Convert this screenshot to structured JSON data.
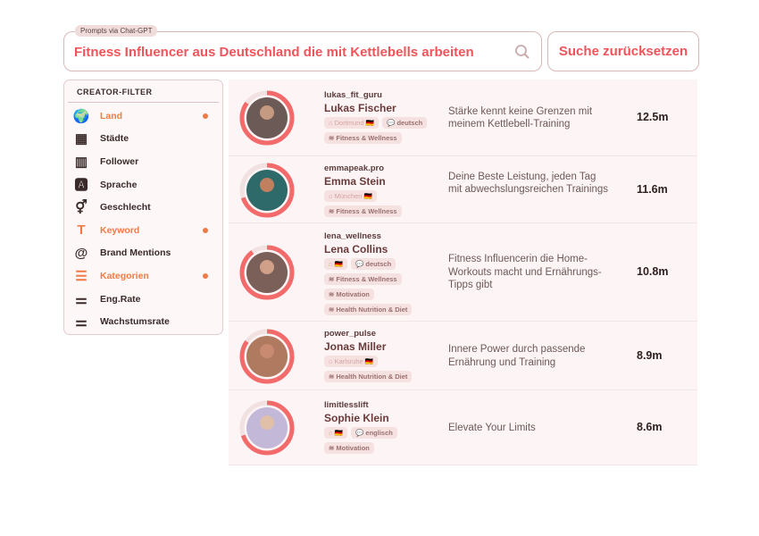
{
  "search": {
    "badge": "Prompts via Chat-GPT",
    "query": "Fitness Influencer aus Deutschland die mit Kettlebells arbeiten",
    "reset_label": "Suche zurücksetzen"
  },
  "filter": {
    "title": "CREATOR-FILTER",
    "items": [
      {
        "label": "Land",
        "icon": "globe-icon",
        "active": true
      },
      {
        "label": "Städte",
        "icon": "buildings-icon",
        "active": false
      },
      {
        "label": "Follower",
        "icon": "bar-chart-icon",
        "active": false
      },
      {
        "label": "Sprache",
        "icon": "translate-icon",
        "active": false
      },
      {
        "label": "Geschlecht",
        "icon": "gender-icon",
        "active": false
      },
      {
        "label": "Keyword",
        "icon": "text-icon",
        "active": true
      },
      {
        "label": "Brand Mentions",
        "icon": "at-icon",
        "active": false
      },
      {
        "label": "Kategorien",
        "icon": "list-icon",
        "active": true
      },
      {
        "label": "Eng.Rate",
        "icon": "sliders-icon",
        "active": false
      },
      {
        "label": "Wachstumsrate",
        "icon": "sliders-icon",
        "active": false
      }
    ]
  },
  "accent": "#f0545a",
  "creators": [
    {
      "handle": "lukas_fit_guru",
      "name": "Lukas Fischer",
      "location": "Dortmund",
      "language": "deutsch",
      "categories": [
        "Fitness & Wellness"
      ],
      "bio": "Stärke kennt keine Grenzen mit meinem Kettlebell-Training",
      "followers": "12.5m",
      "score": 0.85
    },
    {
      "handle": "emmapeak.pro",
      "name": "Emma Stein",
      "location": "München",
      "language": "",
      "categories": [
        "Fitness & Wellness"
      ],
      "bio": "Deine Beste Leistung, jeden Tag mit abwechslungsreichen Trainings",
      "followers": "11.6m",
      "score": 0.7
    },
    {
      "handle": "lena_wellness",
      "name": "Lena Collins",
      "location": "",
      "language": "deutsch",
      "categories": [
        "Fitness & Wellness",
        "Motivation",
        "Health Nutrition & Diet"
      ],
      "bio": "Fitness Influencerin die Home-Workouts macht und Ernährungs-Tipps gibt",
      "followers": "10.8m",
      "score": 0.9
    },
    {
      "handle": "power_pulse",
      "name": "Jonas Miller",
      "location": "Karlsruhe",
      "language": "",
      "categories": [
        "Health Nutrition & Diet"
      ],
      "bio": "Innere Power durch passende Ernährung und Training",
      "followers": "8.9m",
      "score": 0.85
    },
    {
      "handle": "limitlesslift",
      "name": "Sophie Klein",
      "location": "",
      "language": "englisch",
      "categories": [
        "Motivation"
      ],
      "bio": "Elevate Your Limits",
      "followers": "8.6m",
      "score": 0.7
    }
  ]
}
